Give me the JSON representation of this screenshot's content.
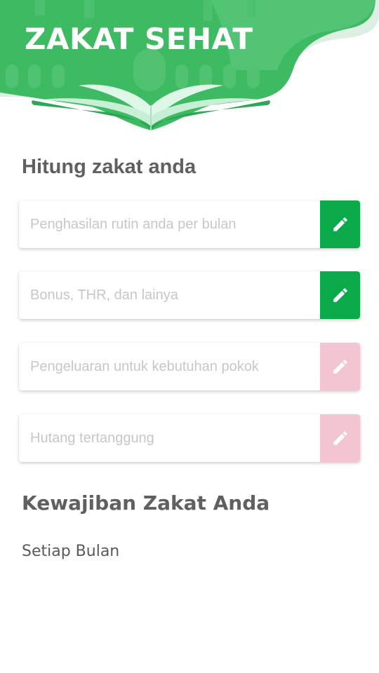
{
  "app": {
    "title": "ZAKAT SEHAT"
  },
  "colors": {
    "brand_green": "#3dba62",
    "button_active": "#0aaa4a",
    "button_inactive": "#f3c4d1"
  },
  "calculator": {
    "heading": "Hitung zakat anda",
    "fields": [
      {
        "placeholder": "Penghasilan rutin anda per bulan",
        "value": "",
        "button_state": "active",
        "button_icon": "pencil-icon"
      },
      {
        "placeholder": "Bonus, THR, dan lainya",
        "value": "",
        "button_state": "active",
        "button_icon": "pencil-icon"
      },
      {
        "placeholder": "Pengeluaran untuk kebutuhan pokok",
        "value": "",
        "button_state": "inactive",
        "button_icon": "pencil-icon"
      },
      {
        "placeholder": "Hutang tertanggung",
        "value": "",
        "button_state": "inactive",
        "button_icon": "pencil-icon"
      }
    ]
  },
  "obligation": {
    "heading": "Kewajiban Zakat Anda",
    "period_label": "Setiap Bulan"
  }
}
